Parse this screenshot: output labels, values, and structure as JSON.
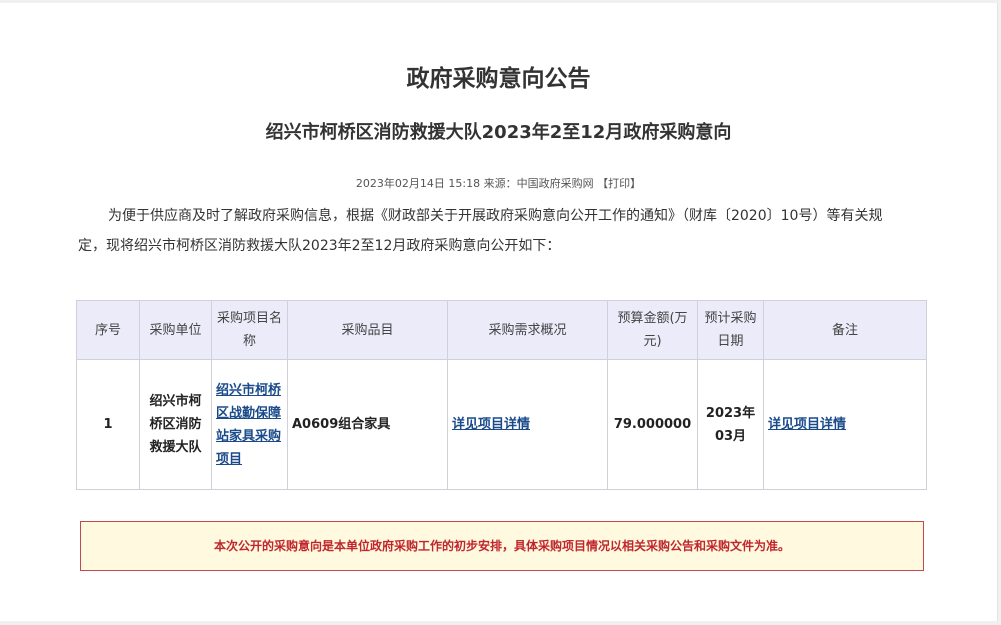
{
  "page": {
    "title": "政府采购意向公告",
    "subtitle": "绍兴市柯桥区消防救援大队2023年2至12月政府采购意向",
    "meta": {
      "datetime": "2023年02月14日 15:18",
      "source_label": "来源：",
      "source": "中国政府采购网",
      "print_label": "【打印】"
    },
    "intro": "为便于供应商及时了解政府采购信息，根据《财政部关于开展政府采购意向公开工作的通知》（财库〔2020〕10号）等有关规定，现将绍兴市柯桥区消防救援大队2023年2至12月政府采购意向公开如下："
  },
  "table": {
    "headers": [
      "序号",
      "采购单位",
      "采购项目名称",
      "采购品目",
      "采购需求概况",
      "预算金额(万元)",
      "预计采购日期",
      "备注"
    ],
    "rows": [
      {
        "index": "1",
        "unit": "绍兴市柯桥区消防救援大队",
        "project_name": "绍兴市柯桥区战勤保障站家具采购项目",
        "category": "A0609组合家具",
        "demand": "详见项目详情",
        "budget": "79.000000",
        "date": "2023年03月",
        "remark": "详见项目详情"
      }
    ]
  },
  "notice": "本次公开的采购意向是本单位政府采购工作的初步安排，具体采购项目情况以相关采购公告和采购文件为准。"
}
